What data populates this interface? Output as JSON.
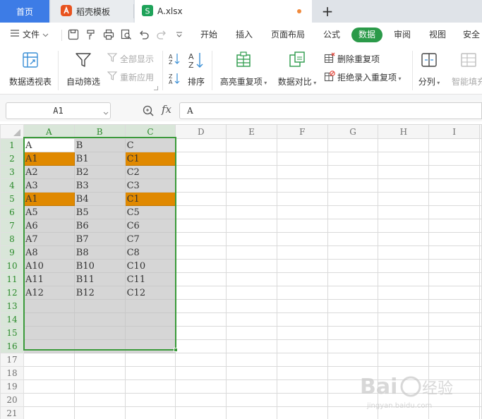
{
  "tabs": {
    "home": "首页",
    "daoke": "稻壳模板",
    "file": "A.xlsx",
    "new_tab": "+"
  },
  "menu": {
    "file_label": "文件",
    "items": [
      "开始",
      "插入",
      "页面布局",
      "公式",
      "数据",
      "审阅",
      "视图",
      "安全"
    ],
    "active": "数据"
  },
  "ribbon": {
    "pivot": "数据透视表",
    "autofilter": "自动筛选",
    "show_all": "全部显示",
    "reapply": "重新应用",
    "sort": "排序",
    "highlight_dup": "高亮重复项",
    "compare": "数据对比",
    "remove_dup": "删除重复项",
    "reject_dup": "拒绝录入重复项",
    "split": "分列",
    "smart_fill": "智能填充"
  },
  "formula_bar": {
    "name_box": "A1",
    "fx": "fx",
    "content": "A"
  },
  "sheet": {
    "columns": [
      "A",
      "B",
      "C",
      "D",
      "E",
      "F",
      "G",
      "H",
      "I"
    ],
    "rows": [
      [
        "A",
        "B",
        "C"
      ],
      [
        "A1",
        "B1",
        "C1"
      ],
      [
        "A2",
        "B2",
        "C2"
      ],
      [
        "A3",
        "B3",
        "C3"
      ],
      [
        "A1",
        "B4",
        "C1"
      ],
      [
        "A5",
        "B5",
        "C5"
      ],
      [
        "A6",
        "B6",
        "C6"
      ],
      [
        "A7",
        "B7",
        "C7"
      ],
      [
        "A8",
        "B8",
        "C8"
      ],
      [
        "A10",
        "B10",
        "C10"
      ],
      [
        "A11",
        "B11",
        "C11"
      ],
      [
        "A12",
        "B12",
        "C12"
      ],
      [
        "",
        "",
        ""
      ],
      [
        "",
        "",
        ""
      ],
      [
        "",
        "",
        ""
      ],
      [
        "",
        "",
        ""
      ],
      [
        "",
        "",
        ""
      ],
      [
        "",
        "",
        ""
      ],
      [
        "",
        "",
        ""
      ],
      [
        "",
        "",
        ""
      ],
      [
        "",
        "",
        ""
      ]
    ],
    "duplicate_highlights": [
      [
        1,
        0
      ],
      [
        1,
        2
      ],
      [
        4,
        0
      ],
      [
        4,
        2
      ]
    ],
    "selection": {
      "range": "A1:C16",
      "active_cell": "A1"
    }
  },
  "colors": {
    "accent_green": "#3a9a3a",
    "duplicate_fill": "#e08900",
    "selection_fill": "#d6d6d6",
    "home_tab": "#3d7ce6"
  },
  "watermark": {
    "brand": "Baidu经验",
    "url": "jingyan.baidu.com"
  }
}
